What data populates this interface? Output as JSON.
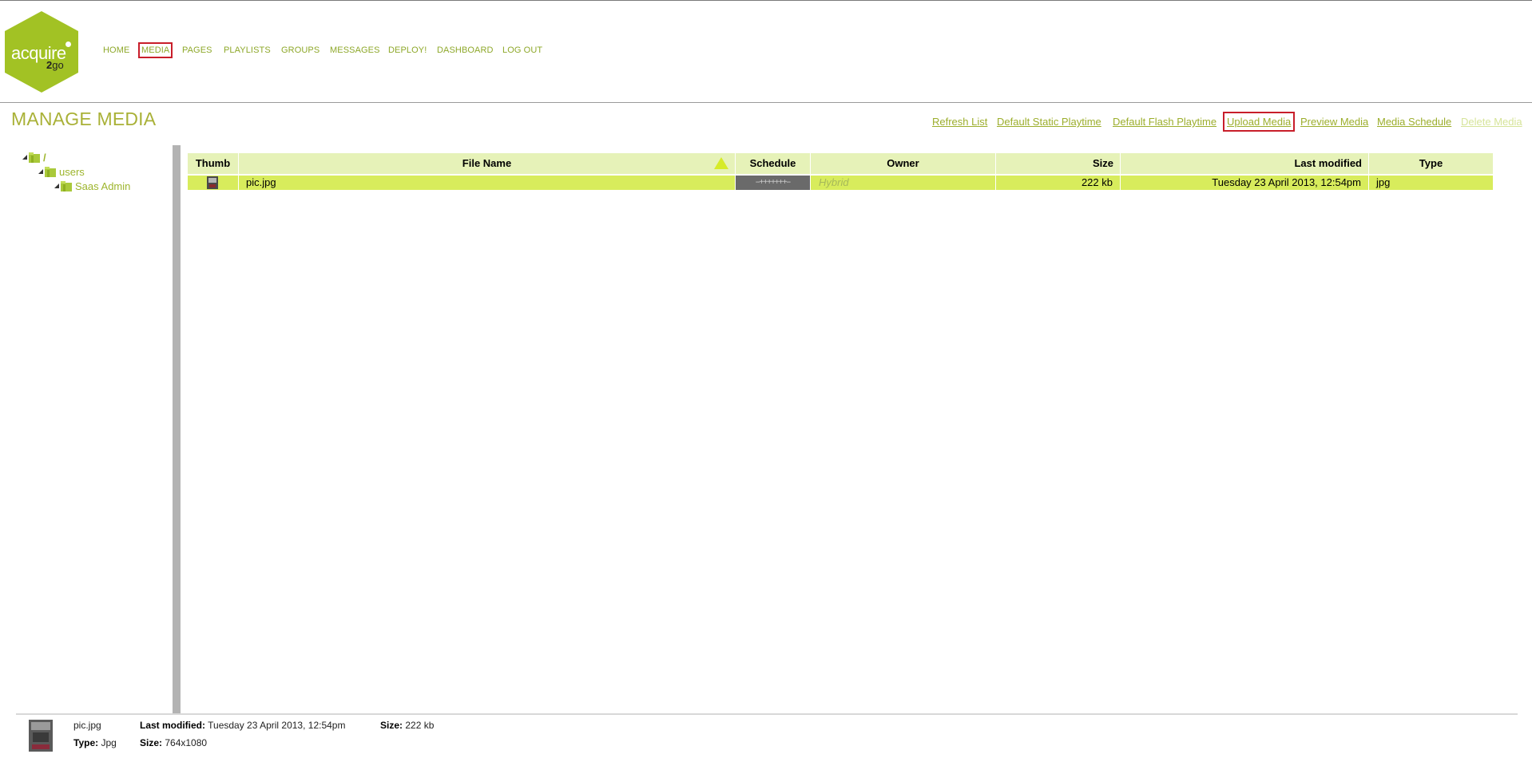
{
  "logo": {
    "word": "acquire",
    "sub_num": "2",
    "sub_text": "go",
    "color": "#a2c224"
  },
  "nav": {
    "home": "HOME",
    "media": "MEDIA",
    "pages": "PAGES",
    "playlists": "PLAYLISTS",
    "groups": "GROUPS",
    "messages": "MESSAGES",
    "deploy": "DEPLOY!",
    "dashboard": "DASHBOARD",
    "logout": "LOG OUT"
  },
  "page_title": "MANAGE MEDIA",
  "actions": {
    "refresh": "Refresh List",
    "static_playtime": "Default Static Playtime",
    "flash_playtime": "Default Flash Playtime",
    "upload": "Upload Media",
    "preview": "Preview Media",
    "schedule": "Media Schedule",
    "delete": "Delete Media"
  },
  "tree": {
    "root": "/",
    "users": "users",
    "saas_admin": "Saas Admin"
  },
  "table": {
    "columns": {
      "thumb": "Thumb",
      "file_name": "File Name",
      "schedule": "Schedule",
      "owner": "Owner",
      "size": "Size",
      "last_modified": "Last modified",
      "type": "Type"
    },
    "rows": [
      {
        "file_name": "pic.jpg",
        "schedule": "--+++++++--",
        "owner": "Hybrid",
        "size": "222 kb",
        "last_modified": "Tuesday 23 April 2013, 12:54pm",
        "type": "jpg"
      }
    ]
  },
  "details": {
    "file_name": "pic.jpg",
    "last_modified_label": "Last modified:",
    "last_modified_value": "Tuesday 23 April 2013, 12:54pm",
    "size_label": "Size:",
    "size_value": "222 kb",
    "type_label": "Type:",
    "type_value": "Jpg",
    "dims_label": "Size:",
    "dims_value": "764x1080"
  },
  "colors": {
    "accent_green": "#a9b137",
    "row_selected": "#d8ec5c",
    "header_bg": "#e6f2b8",
    "highlight_red": "#c81e2a"
  }
}
